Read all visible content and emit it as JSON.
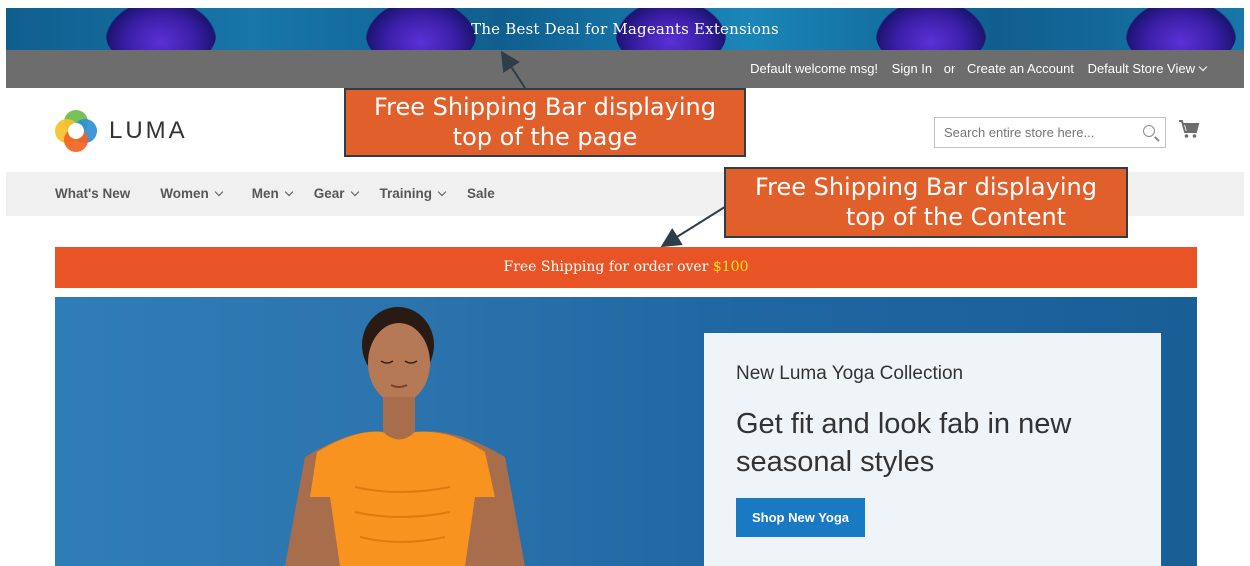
{
  "promo_bar": {
    "text": "The Best Deal for Mageants Extensions"
  },
  "header_links": {
    "welcome": "Default welcome msg!",
    "sign_in": "Sign In",
    "or": "or",
    "create_account": "Create an Account",
    "store_view": "Default Store View"
  },
  "logo": {
    "text": "LUMA",
    "icon": "luma-logo-icon"
  },
  "search": {
    "placeholder": "Search entire store here...",
    "icon": "search-icon"
  },
  "cart": {
    "icon": "cart-icon"
  },
  "nav": {
    "items": [
      {
        "label": "What's New",
        "dropdown": false
      },
      {
        "label": "Women",
        "dropdown": true
      },
      {
        "label": "Men",
        "dropdown": true
      },
      {
        "label": "Gear",
        "dropdown": true
      },
      {
        "label": "Training",
        "dropdown": true
      },
      {
        "label": "Sale",
        "dropdown": false
      }
    ]
  },
  "shipping_bar": {
    "text": "Free Shipping for order over",
    "amount": "$100"
  },
  "hero": {
    "subtitle": "New Luma Yoga Collection",
    "title": "Get fit and look fab in new seasonal styles",
    "button": "Shop New Yoga"
  },
  "annotations": {
    "top": [
      "Free Shipping Bar displaying",
      "top of the page"
    ],
    "content": [
      "Free Shipping Bar displaying",
      "top of the Content"
    ]
  },
  "colors": {
    "shipping_bar": "#e85425",
    "shipping_amount": "#ffe21f",
    "header_links_bg": "#6d6d6d",
    "nav_bg": "#f0f0f0",
    "button": "#1979c3",
    "callout": "#e05f2b"
  }
}
